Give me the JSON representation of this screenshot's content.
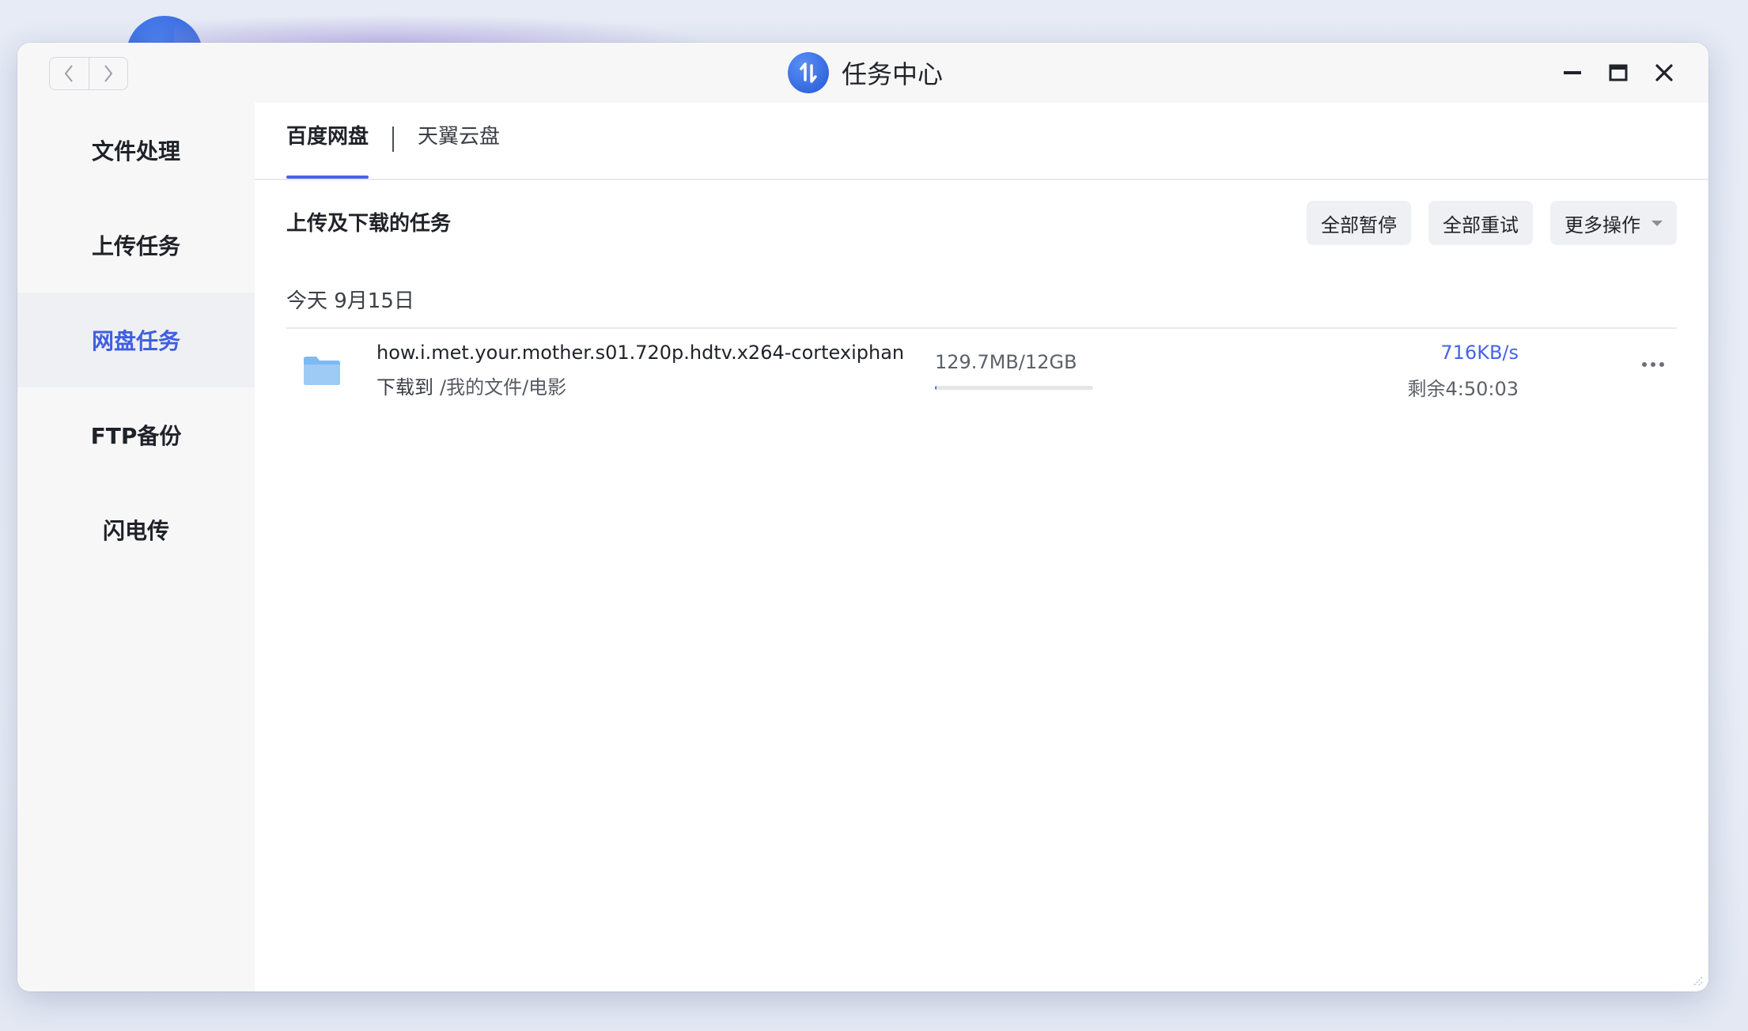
{
  "window": {
    "title": "任务中心"
  },
  "sidebar": {
    "items": [
      {
        "label": "文件处理"
      },
      {
        "label": "上传任务"
      },
      {
        "label": "网盘任务"
      },
      {
        "label": "FTP备份"
      },
      {
        "label": "闪电传"
      }
    ],
    "active_index": 2
  },
  "tabs": [
    {
      "label": "百度网盘"
    },
    {
      "label": "天翼云盘"
    }
  ],
  "section": {
    "title": "上传及下载的任务"
  },
  "actions": {
    "pause_all": "全部暂停",
    "retry_all": "全部重试",
    "more_ops": "更多操作"
  },
  "group": {
    "date_label": "今天 9月15日"
  },
  "tasks": [
    {
      "name": "how.i.met.your.mother.s01.720p.hdtv.x264-cortexiphan",
      "dest_prefix": "下载到",
      "dest_path": "/我的文件/电影",
      "size": "129.7MB/12GB",
      "progress": 0.011,
      "speed": "716KB/s",
      "remaining": "剩余4:50:03"
    }
  ],
  "colors": {
    "accent": "#4763e8",
    "sidebar_active_bg": "#eff0f3",
    "folder": "#7fb9f2"
  }
}
